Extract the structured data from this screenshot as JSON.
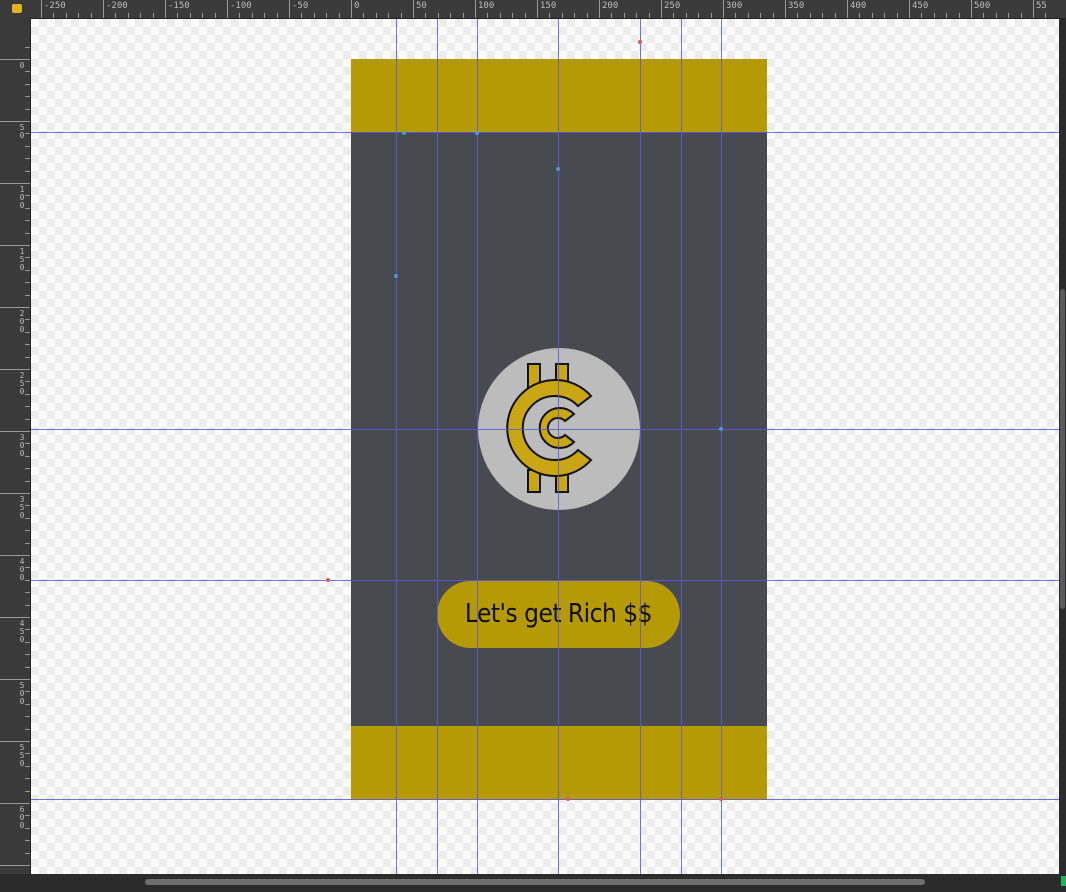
{
  "editor": {
    "ruler_top_labels": [
      "-250",
      "-200",
      "-150",
      "-100",
      "-50",
      "0",
      "50",
      "100",
      "150",
      "200",
      "250",
      "300",
      "350",
      "400",
      "450",
      "500",
      "55"
    ],
    "ruler_left_labels": [
      "0",
      "50",
      "100",
      "150",
      "200",
      "250",
      "300",
      "350",
      "400",
      "450",
      "500",
      "550",
      "600"
    ],
    "lock_icon": "lock-icon",
    "accent": "#b59a05",
    "guide_color": "#5a5ad8"
  },
  "phone": {
    "background": "#474a51",
    "bar_color": "#b59a05",
    "logo_icon": "coin-logo-icon",
    "button_label": "Let's get Rich $$"
  }
}
